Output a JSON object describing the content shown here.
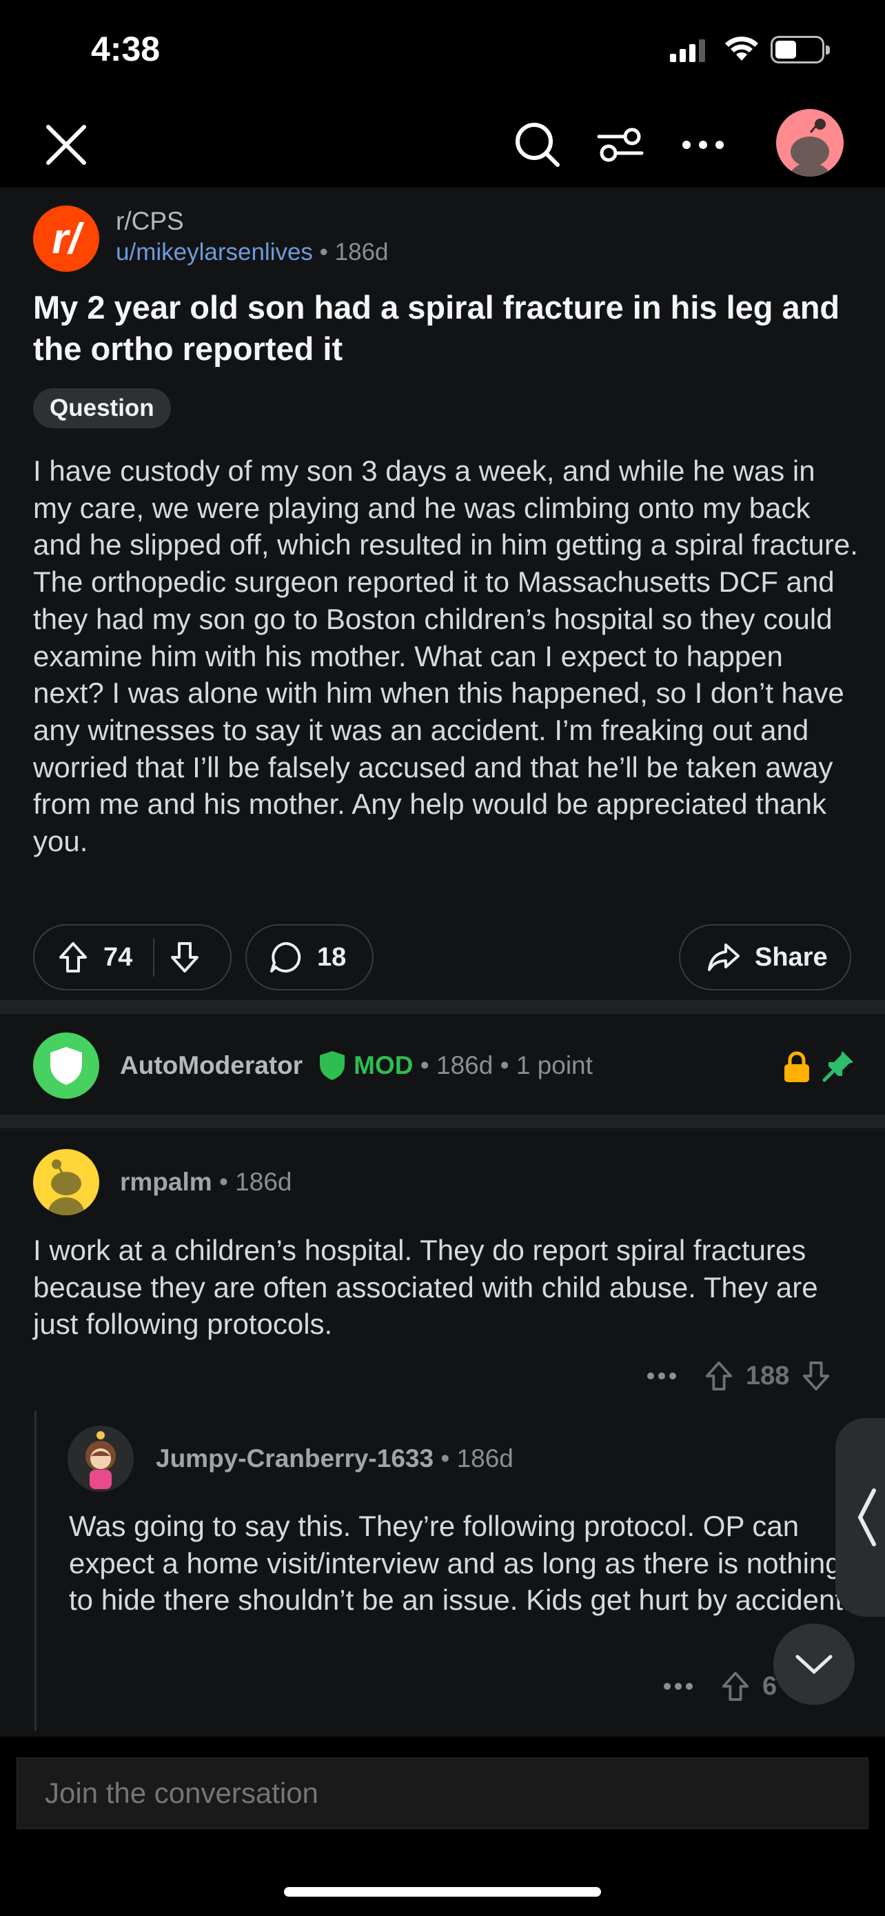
{
  "status_bar": {
    "time": "4:38"
  },
  "post": {
    "subreddit": "r/CPS",
    "author": "u/mikeylarsenlives",
    "age": "186d",
    "title": "My 2 year old son had a spiral fracture in his leg and the ortho reported it",
    "flair": "Question",
    "body": "I have custody of my son 3 days a week, and while he was in my care, we were playing and he was climbing onto my back and he slipped off, which resulted in him getting a spiral fracture. The orthopedic surgeon reported it to Massachusetts DCF and they had my son go to Boston children’s hospital so they could examine him with his mother. What can I expect to happen next? I was alone with him when this happened, so I don’t have any witnesses to say it was an accident. I’m freaking out and worried that I’ll be falsely accused and that he’ll be taken away from me and his mother. Any help would be appreciated thank you.",
    "votes": "74",
    "comments": "18",
    "share_label": "Share"
  },
  "automod": {
    "name": "AutoModerator",
    "badge": "MOD",
    "age": "186d",
    "points": "1 point"
  },
  "comments": [
    {
      "author": "rmpalm",
      "age": "186d",
      "body": "I work at a children’s hospital. They do report spiral fractures because they are often associated with child abuse. They are just following protocols.",
      "votes": "188"
    },
    {
      "author": "Jumpy-Cranberry-1633",
      "age": "186d",
      "body": "Was going to say this. They’re following protocol. OP can expect a home visit/interview and as long as there is nothing to hide there shouldn’t be an issue. Kids get hurt by accident.",
      "votes": "6"
    }
  ],
  "composer": {
    "placeholder": "Join the conversation"
  },
  "colors": {
    "background": "#000000",
    "card": "#121315",
    "accent": "#ff4500",
    "mod_green": "#46d160",
    "link_blue": "#6e9bdc"
  }
}
